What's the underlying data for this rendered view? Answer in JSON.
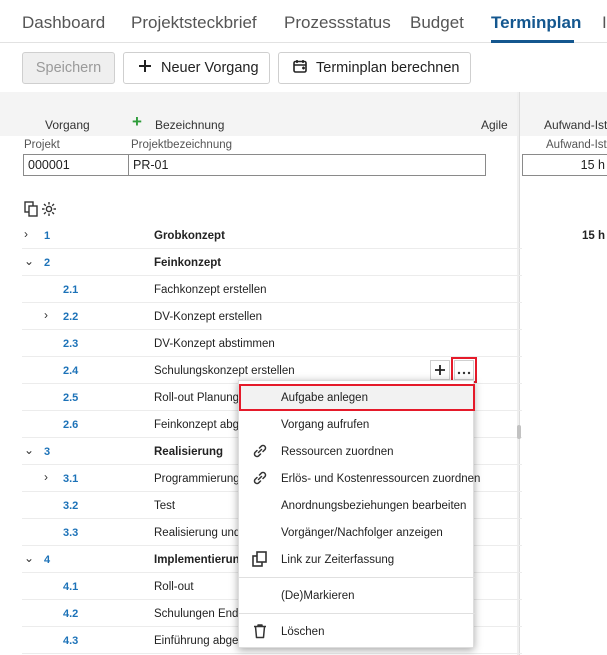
{
  "tabs": [
    {
      "label": "Dashboard"
    },
    {
      "label": "Projektsteckbrief"
    },
    {
      "label": "Prozessstatus"
    },
    {
      "label": "Budget"
    },
    {
      "label": "Terminplan"
    },
    {
      "label": "I"
    }
  ],
  "toolbar": {
    "save_label": "Speichern",
    "new_task_label": "Neuer Vorgang",
    "calc_label": "Terminplan berechnen"
  },
  "columns": {
    "vorgang": "Vorgang",
    "bezeichnung": "Bezeichnung",
    "agile": "Agile",
    "aufwand_ist": "Aufwand-Ist"
  },
  "project": {
    "project_label": "Projekt",
    "project_value": "000001",
    "name_label": "Projektbezeichnung",
    "name_value": "PR-01",
    "effort_label": "Aufwand-Ist",
    "effort_value": "15 h"
  },
  "rows": [
    {
      "num": "1",
      "name": "Grobkonzept",
      "right": "15 h"
    },
    {
      "num": "2",
      "name": "Feinkonzept"
    },
    {
      "num": "2.1",
      "name": "Fachkonzept erstellen"
    },
    {
      "num": "2.2",
      "name": "DV-Konzept erstellen"
    },
    {
      "num": "2.3",
      "name": "DV-Konzept abstimmen"
    },
    {
      "num": "2.4",
      "name": "Schulungskonzept erstellen"
    },
    {
      "num": "2.5",
      "name": "Roll-out Planung"
    },
    {
      "num": "2.6",
      "name": "Feinkonzept abge"
    },
    {
      "num": "3",
      "name": "Realisierung"
    },
    {
      "num": "3.1",
      "name": "Programmierung"
    },
    {
      "num": "3.2",
      "name": "Test"
    },
    {
      "num": "3.3",
      "name": "Realisierung und"
    },
    {
      "num": "4",
      "name": "Implementierung"
    },
    {
      "num": "4.1",
      "name": "Roll-out"
    },
    {
      "num": "4.2",
      "name": "Schulungen Enda"
    },
    {
      "num": "4.3",
      "name": "Einführung abges"
    }
  ],
  "menu": [
    {
      "label": "Aufgabe anlegen"
    },
    {
      "label": "Vorgang aufrufen"
    },
    {
      "label": "Ressourcen zuordnen"
    },
    {
      "label": "Erlös- und Kostenressourcen zuordnen"
    },
    {
      "label": "Anordnungsbeziehungen bearbeiten"
    },
    {
      "label": "Vorgänger/Nachfolger anzeigen"
    },
    {
      "label": "Link zur Zeiterfassung"
    },
    {
      "label": "(De)Markieren"
    },
    {
      "label": "Löschen"
    }
  ],
  "icons": {
    "plus": "plus-icon",
    "calendar": "calendar-icon",
    "link": "link-icon",
    "copy": "copy-icon",
    "trash": "trash-icon",
    "more": "more-icon",
    "settings": "gear-icon",
    "chevron": "chevron-icon"
  },
  "colors": {
    "accent": "#14578f",
    "number": "#1c72b8",
    "highlight": "#e51a2a",
    "add_green": "#2e9c3a"
  }
}
